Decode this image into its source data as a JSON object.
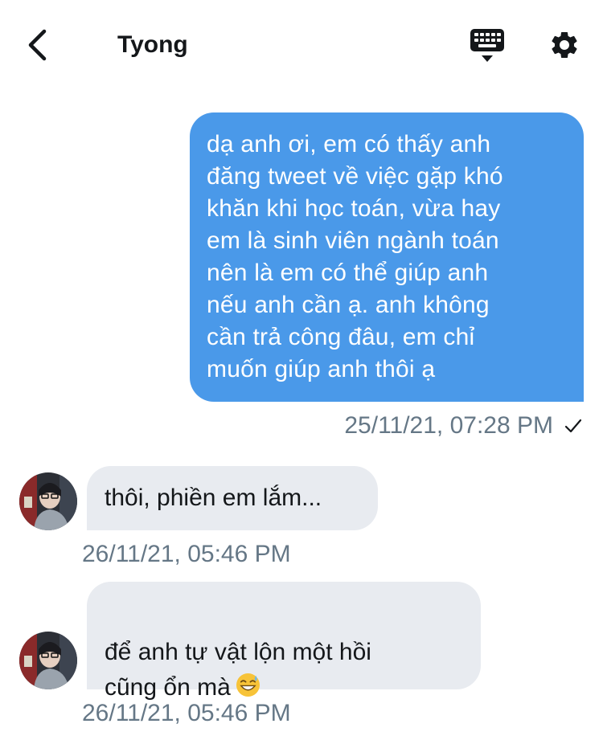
{
  "header": {
    "title": "Tyong",
    "icons": [
      "back-chevron-icon",
      "keyboard-icon",
      "gear-icon"
    ]
  },
  "messages": [
    {
      "direction": "outgoing",
      "text": "dạ anh ơi, em có thấy anh\nđăng tweet về việc gặp khó\nkhăn khi học toán, vừa hay\nem là sinh viên ngành toán\nnên là em có thể giúp anh\nnếu anh cần ạ. anh không\ncần trả công đâu, em chỉ\nmuốn giúp anh thôi ạ",
      "timestamp": "25/11/21, 07:28 PM",
      "status_icon": "checkmark-icon"
    },
    {
      "direction": "incoming",
      "text": "thôi, phiền em lắm...",
      "timestamp": "26/11/21, 05:46 PM"
    },
    {
      "direction": "incoming",
      "text": "để anh tự vật lộn một hồi\ncũng ổn mà",
      "emoji": "grinning-sweat-emoji",
      "timestamp": "26/11/21, 05:46 PM"
    }
  ],
  "colors": {
    "outgoing_bubble": "#4a99e9",
    "incoming_bubble": "#e8ebf0",
    "timestamp": "#657786",
    "text": "#14171a"
  }
}
